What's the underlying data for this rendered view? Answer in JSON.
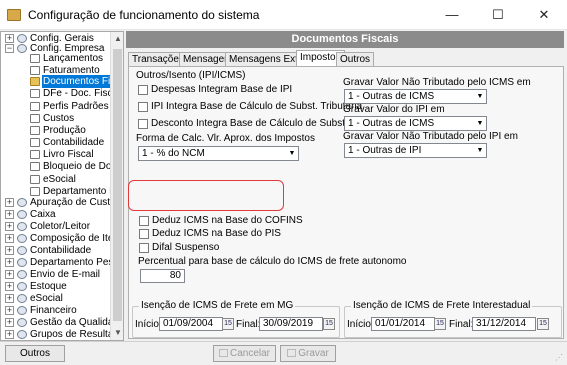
{
  "window": {
    "title": "Configuração de funcionamento do sistema",
    "minimize": "—",
    "maximize": "☐",
    "close": "✕"
  },
  "tree": {
    "items": [
      {
        "label": "Config. Gerais"
      },
      {
        "label": "Config. Empresa"
      },
      {
        "label": "Lançamentos"
      },
      {
        "label": "Faturamento"
      },
      {
        "label": "Documentos Fiscais"
      },
      {
        "label": "DFe - Doc. Fiscais E"
      },
      {
        "label": "Perfis Padrões"
      },
      {
        "label": "Custos"
      },
      {
        "label": "Produção"
      },
      {
        "label": "Contabilidade"
      },
      {
        "label": "Livro Fiscal"
      },
      {
        "label": "Bloqueio de Docume"
      },
      {
        "label": "eSocial"
      },
      {
        "label": "Departamento Pesso"
      },
      {
        "label": "Apuração de Custo"
      },
      {
        "label": "Caixa"
      },
      {
        "label": "Coletor/Leitor"
      },
      {
        "label": "Composição de Itens"
      },
      {
        "label": "Contabilidade"
      },
      {
        "label": "Departamento Pessoal"
      },
      {
        "label": "Envio de E-mail"
      },
      {
        "label": "Estoque"
      },
      {
        "label": "eSocial"
      },
      {
        "label": "Financeiro"
      },
      {
        "label": "Gestão da Qualidade"
      },
      {
        "label": "Grupos de Resultado"
      }
    ],
    "expand_open": "−",
    "expand_closed": "+"
  },
  "panel": {
    "header": "Documentos Fiscais",
    "tabs": [
      "Transações",
      "Mensagens",
      "Mensagens Extras",
      "Impostos",
      "Outros"
    ]
  },
  "impostos": {
    "group_title": "Outros/Isento (IPI/ICMS)",
    "check_despesas": "Despesas Integram Base de IPI",
    "check_ipi_integra": "IPI Integra Base de Cálculo de Subst. Tributária",
    "check_desconto": "Desconto Integra Base de Cálculo de Subst. Tributária",
    "forma_calc_label": "Forma de Calc. Vlr. Aprox. dos Impostos",
    "forma_calc_value": "1 - % do NCM",
    "gravar_nt_icms_label": "Gravar Valor Não Tributado pelo ICMS em",
    "gravar_nt_icms_value": "1 - Outras de ICMS",
    "gravar_ipi_label": "Gravar Valor do IPI em",
    "gravar_ipi_value": "1 - Outras de ICMS",
    "gravar_nt_ipi_label": "Gravar Valor Não Tributado pelo IPI em",
    "gravar_nt_ipi_value": "1 - Outras de IPI",
    "check_deduz_cofins": "Deduz ICMS na Base do COFINS",
    "check_deduz_pis": "Deduz ICMS na Base do PIS",
    "check_difal": "Difal Suspenso",
    "percentual_label": "Percentual para base de cálculo do ICMS de frete autonomo",
    "percentual_value": "80",
    "mg_title": "Isenção de ICMS de Frete em MG",
    "mg_inicio_label": "Início:",
    "mg_inicio": "01/09/2004",
    "mg_final_label": "Final:",
    "mg_final": "30/09/2019",
    "inter_title": "Isenção de ICMS de Frete Interestadual",
    "inter_inicio_label": "Início:",
    "inter_inicio": "01/01/2014",
    "inter_final_label": "Final:",
    "inter_final": "31/12/2014",
    "cal_icon_text": "15"
  },
  "footer": {
    "outros": "Outros",
    "cancelar": "Cancelar",
    "gravar": "Gravar"
  },
  "colors": {
    "selection": "#0078d7",
    "header_bar": "#8b8b8b",
    "highlight_outline": "#e23a3a"
  }
}
